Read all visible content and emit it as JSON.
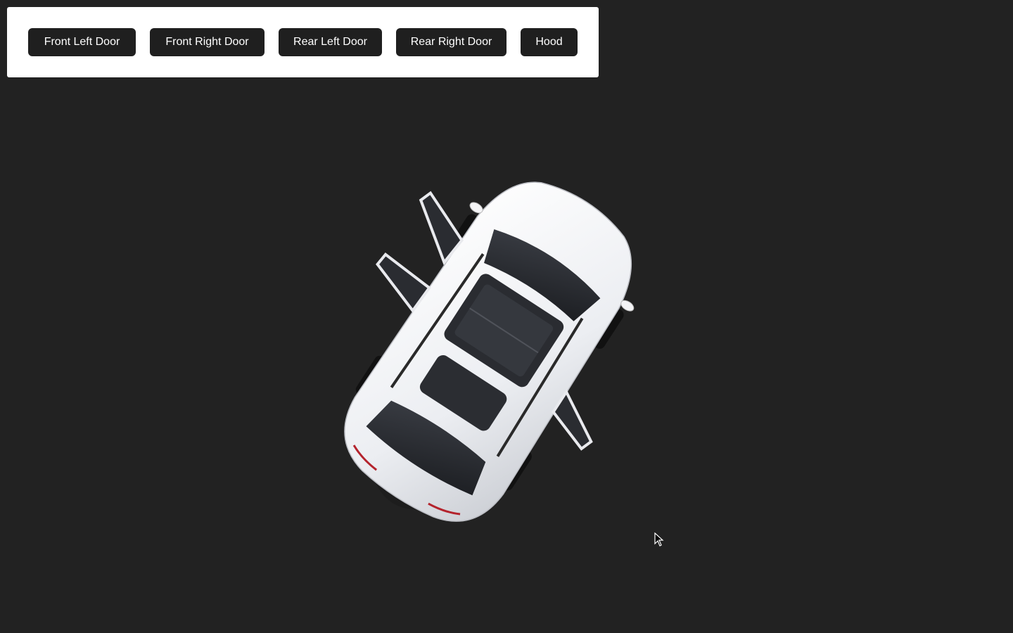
{
  "toolbar": {
    "buttons": [
      {
        "label": "Front Left Door"
      },
      {
        "label": "Front Right Door"
      },
      {
        "label": "Rear Left Door"
      },
      {
        "label": "Rear Right Door"
      },
      {
        "label": "Hood"
      }
    ]
  },
  "scene": {
    "object": "white-suv-3d-model",
    "background_color": "#222222",
    "car_color": "#f2f2f4"
  },
  "cursor": {
    "icon": "arrow-pointer-icon"
  }
}
